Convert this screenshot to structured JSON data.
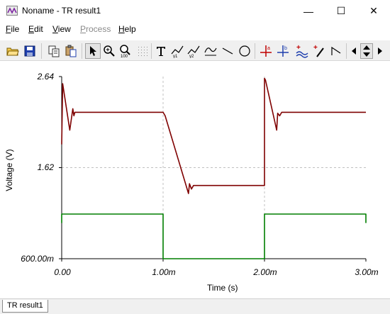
{
  "window": {
    "title": "Noname - TR result1",
    "controls": {
      "minimize": "—",
      "maximize": "☐",
      "close": "✕"
    }
  },
  "menu": {
    "items": [
      {
        "label": "File",
        "hotkey": "F",
        "rest": "ile",
        "enabled": true
      },
      {
        "label": "Edit",
        "hotkey": "E",
        "rest": "dit",
        "enabled": true
      },
      {
        "label": "View",
        "hotkey": "V",
        "rest": "iew",
        "enabled": true
      },
      {
        "label": "Process",
        "hotkey": "P",
        "rest": "rocess",
        "enabled": false
      },
      {
        "label": "Help",
        "hotkey": "H",
        "rest": "elp",
        "enabled": true
      }
    ]
  },
  "toolbar": {
    "icons": [
      "open-icon",
      "save-icon",
      "copy-icon",
      "paste-icon",
      "pointer-icon",
      "zoom-in-icon",
      "zoom-100-icon",
      "grid-icon",
      "text-tool-icon",
      "curve-tool-1-icon",
      "curve-tool-2-icon",
      "curve-tool-3-icon",
      "line-tool-icon",
      "circle-tool-icon",
      "cursor-a-icon",
      "cursor-b-icon",
      "add-curve-icon",
      "probe-icon",
      "arrow-tool-icon",
      "scroll-left-icon",
      "scroll-updown-icon",
      "scroll-right-icon"
    ]
  },
  "chart_data": {
    "type": "line",
    "xlabel": "Time (s)",
    "ylabel": "Voltage (V)",
    "xlim": [
      0,
      0.003
    ],
    "ylim": [
      0.6,
      2.64
    ],
    "x_ticks": [
      "0.00",
      "1.00m",
      "2.00m",
      "3.00m"
    ],
    "y_ticks": [
      "2.64",
      "1.62",
      "600.00m"
    ],
    "grid": true,
    "colors": {
      "series1": "#7f0000",
      "series2": "#007f00",
      "grid": "#c0c0c0"
    },
    "series": [
      {
        "color": "#7f0000",
        "x": [
          0,
          1e-05,
          8e-05,
          0.00011,
          0.00012,
          0.00013,
          0.00015,
          0.001,
          0.00102,
          0.00125,
          0.00126,
          0.00128,
          0.0013,
          0.002,
          0.002,
          0.00201,
          0.00212,
          0.00213,
          0.00215,
          0.00217,
          0.003
        ],
        "y": [
          1.88,
          2.56,
          2.04,
          2.28,
          2.2,
          2.24,
          2.24,
          2.24,
          2.2,
          1.33,
          1.44,
          1.38,
          1.42,
          1.42,
          2.62,
          2.6,
          2.04,
          2.23,
          2.2,
          2.24,
          2.24
        ]
      },
      {
        "color": "#007f00",
        "x": [
          0,
          0,
          0.001,
          0.001,
          0.002,
          0.002,
          0.003,
          0.003
        ],
        "y": [
          1.0,
          1.1,
          1.1,
          0.6,
          0.6,
          1.1,
          1.1,
          1.0
        ]
      }
    ]
  },
  "status": {
    "tab_label": "TR result1"
  }
}
